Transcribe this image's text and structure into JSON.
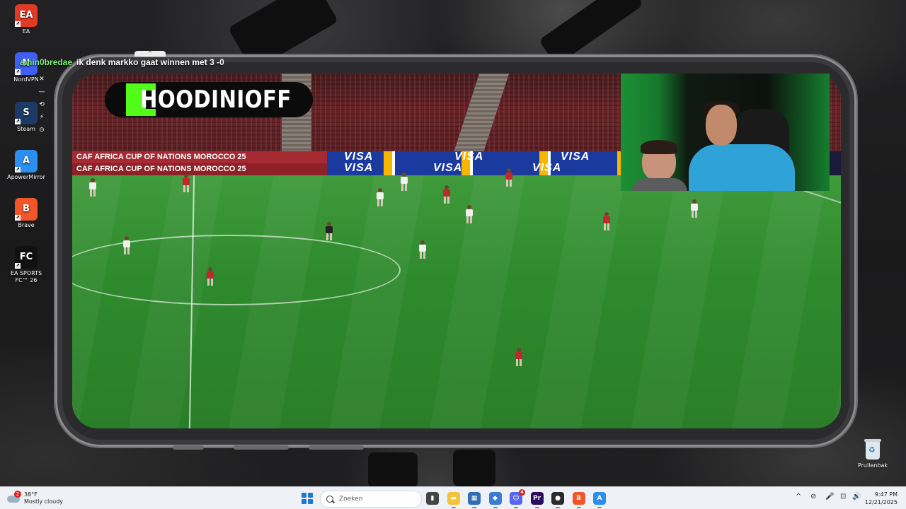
{
  "desktop": {
    "icons": [
      {
        "label": "EA",
        "glyph": "EA",
        "color": "#e23b25",
        "icon": "ea-icon"
      },
      {
        "label": "NordVPN",
        "glyph": "N",
        "color": "#3e5ff2",
        "icon": "nordvpn-icon"
      },
      {
        "label": "Steam",
        "glyph": "S",
        "color": "#1b3a66",
        "icon": "steam-icon"
      },
      {
        "label": "ApowerMirror",
        "glyph": "A",
        "color": "#2b8ff0",
        "icon": "apowermirror-icon"
      },
      {
        "label": "Brave",
        "glyph": "B",
        "color": "#f1562b",
        "icon": "brave-icon"
      },
      {
        "label": "EA SPORTS FC™ 26",
        "glyph": "FC",
        "color": "#111111",
        "icon": "ea-fc-26-icon"
      }
    ],
    "recycle_bin": {
      "label": "Prullenbak",
      "icon": "recycle-bin-icon"
    }
  },
  "chat": {
    "username": "amin0bredae",
    "message": "ik denk markko gaat winnen met 3 -0",
    "handle_glyph": "^",
    "tools": [
      "✕",
      "—",
      "⟲",
      "⚡",
      "⊙"
    ]
  },
  "stream": {
    "channel_name": "HOODINIOFF",
    "ad_caf_line1": "CAF  AFRICA CUP OF NATIONS  MOROCCO 25",
    "ad_caf_line2": "CAF  AFRICA CUP OF NATIONS  MOROCCO 25",
    "ad_visa": "VISA",
    "accent_color": "#53fc18"
  },
  "taskbar": {
    "weather": {
      "temp": "38°F",
      "condition": "Mostly cloudy",
      "badge": "2"
    },
    "search_placeholder": "Zoeken",
    "apps": [
      {
        "name": "task-view",
        "glyph": "▮",
        "color": "#444444"
      },
      {
        "name": "file-explorer",
        "glyph": "▬",
        "color": "#f3c33b"
      },
      {
        "name": "calculator",
        "glyph": "▦",
        "color": "#2f6db4"
      },
      {
        "name": "vpn",
        "glyph": "◆",
        "color": "#3b7bd6"
      },
      {
        "name": "discord",
        "glyph": "☺",
        "color": "#5865f2",
        "badge": "4"
      },
      {
        "name": "premiere-pro",
        "glyph": "Pr",
        "color": "#2a0b5c"
      },
      {
        "name": "obs",
        "glyph": "●",
        "color": "#2b2b2b"
      },
      {
        "name": "brave",
        "glyph": "B",
        "color": "#f1562b"
      },
      {
        "name": "apowermirror",
        "glyph": "A",
        "color": "#2b8ff0"
      }
    ],
    "tray": [
      "^",
      "⊘",
      "🎤",
      "⊡",
      "🔊"
    ],
    "time": "9:47 PM",
    "date": "12/21/2025"
  }
}
